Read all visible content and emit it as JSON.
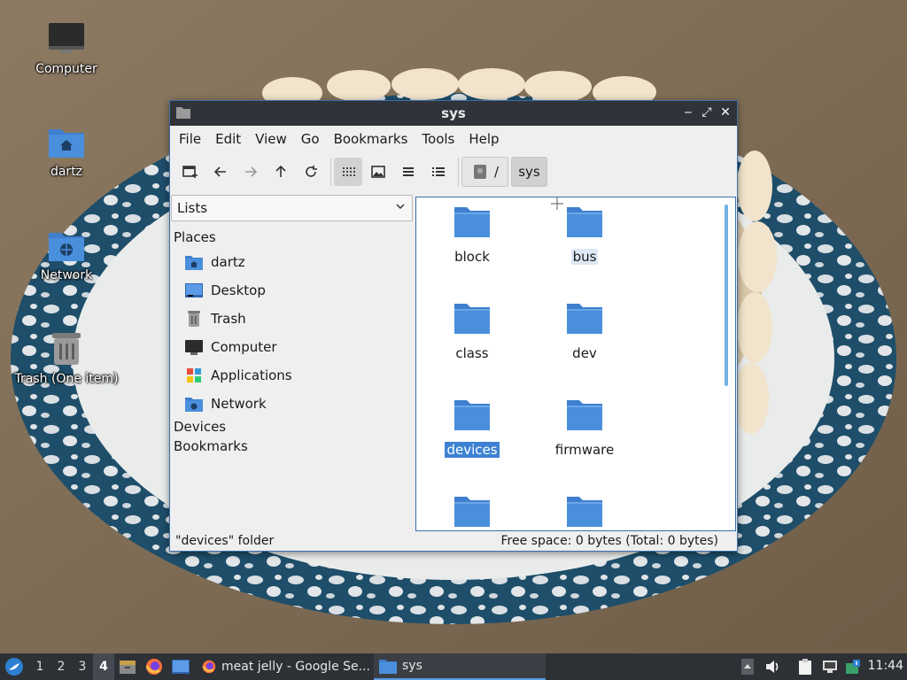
{
  "desktop": {
    "icons": [
      {
        "label": "Computer"
      },
      {
        "label": "dartz"
      },
      {
        "label": "Network"
      },
      {
        "label": "Trash (One item)"
      }
    ]
  },
  "window": {
    "title": "sys",
    "controls": {
      "minimize": "‒",
      "maximize": "⤢",
      "close": "✕"
    },
    "menu": [
      "File",
      "Edit",
      "View",
      "Go",
      "Bookmarks",
      "Tools",
      "Help"
    ],
    "toolbar": {
      "buttons": [
        "new-tab-icon",
        "back-icon",
        "forward-icon",
        "up-icon",
        "reload-icon",
        "icon-view-icon",
        "thumbnail-view-icon",
        "compact-view-icon",
        "detailed-list-view-icon"
      ],
      "path": [
        "/",
        "sys"
      ]
    },
    "side_pane": {
      "mode": "Lists",
      "places_heading": "Places",
      "places": [
        {
          "label": "dartz",
          "icon": "home-folder-icon"
        },
        {
          "label": "Desktop",
          "icon": "desktop-icon"
        },
        {
          "label": "Trash",
          "icon": "trash-icon"
        },
        {
          "label": "Computer",
          "icon": "computer-icon"
        },
        {
          "label": "Applications",
          "icon": "applications-icon"
        },
        {
          "label": "Network",
          "icon": "network-folder-icon"
        }
      ],
      "devices_heading": "Devices",
      "bookmarks_heading": "Bookmarks"
    },
    "files": [
      {
        "name": "block",
        "state": "normal"
      },
      {
        "name": "bus",
        "state": "hover"
      },
      {
        "name": "class",
        "state": "normal"
      },
      {
        "name": "dev",
        "state": "normal"
      },
      {
        "name": "devices",
        "state": "selected"
      },
      {
        "name": "firmware",
        "state": "normal"
      },
      {
        "name": "",
        "state": "normal"
      },
      {
        "name": "",
        "state": "normal"
      }
    ],
    "status": {
      "left": "\"devices\" folder",
      "right": "Free space: 0 bytes (Total: 0 bytes)"
    }
  },
  "taskbar": {
    "workspaces": [
      "1",
      "2",
      "3",
      "4"
    ],
    "active_workspace": "4",
    "tasks": [
      {
        "label": "meat jelly - Google Se...",
        "icon": "firefox-icon"
      },
      {
        "label": "sys",
        "icon": "folder-icon",
        "active": true
      }
    ],
    "clock": "11:44"
  },
  "colors": {
    "folder_blue": "#4a8fdc",
    "selection": "#3d82d2",
    "titlebar": "#30343a",
    "taskbar": "#2d3035"
  }
}
